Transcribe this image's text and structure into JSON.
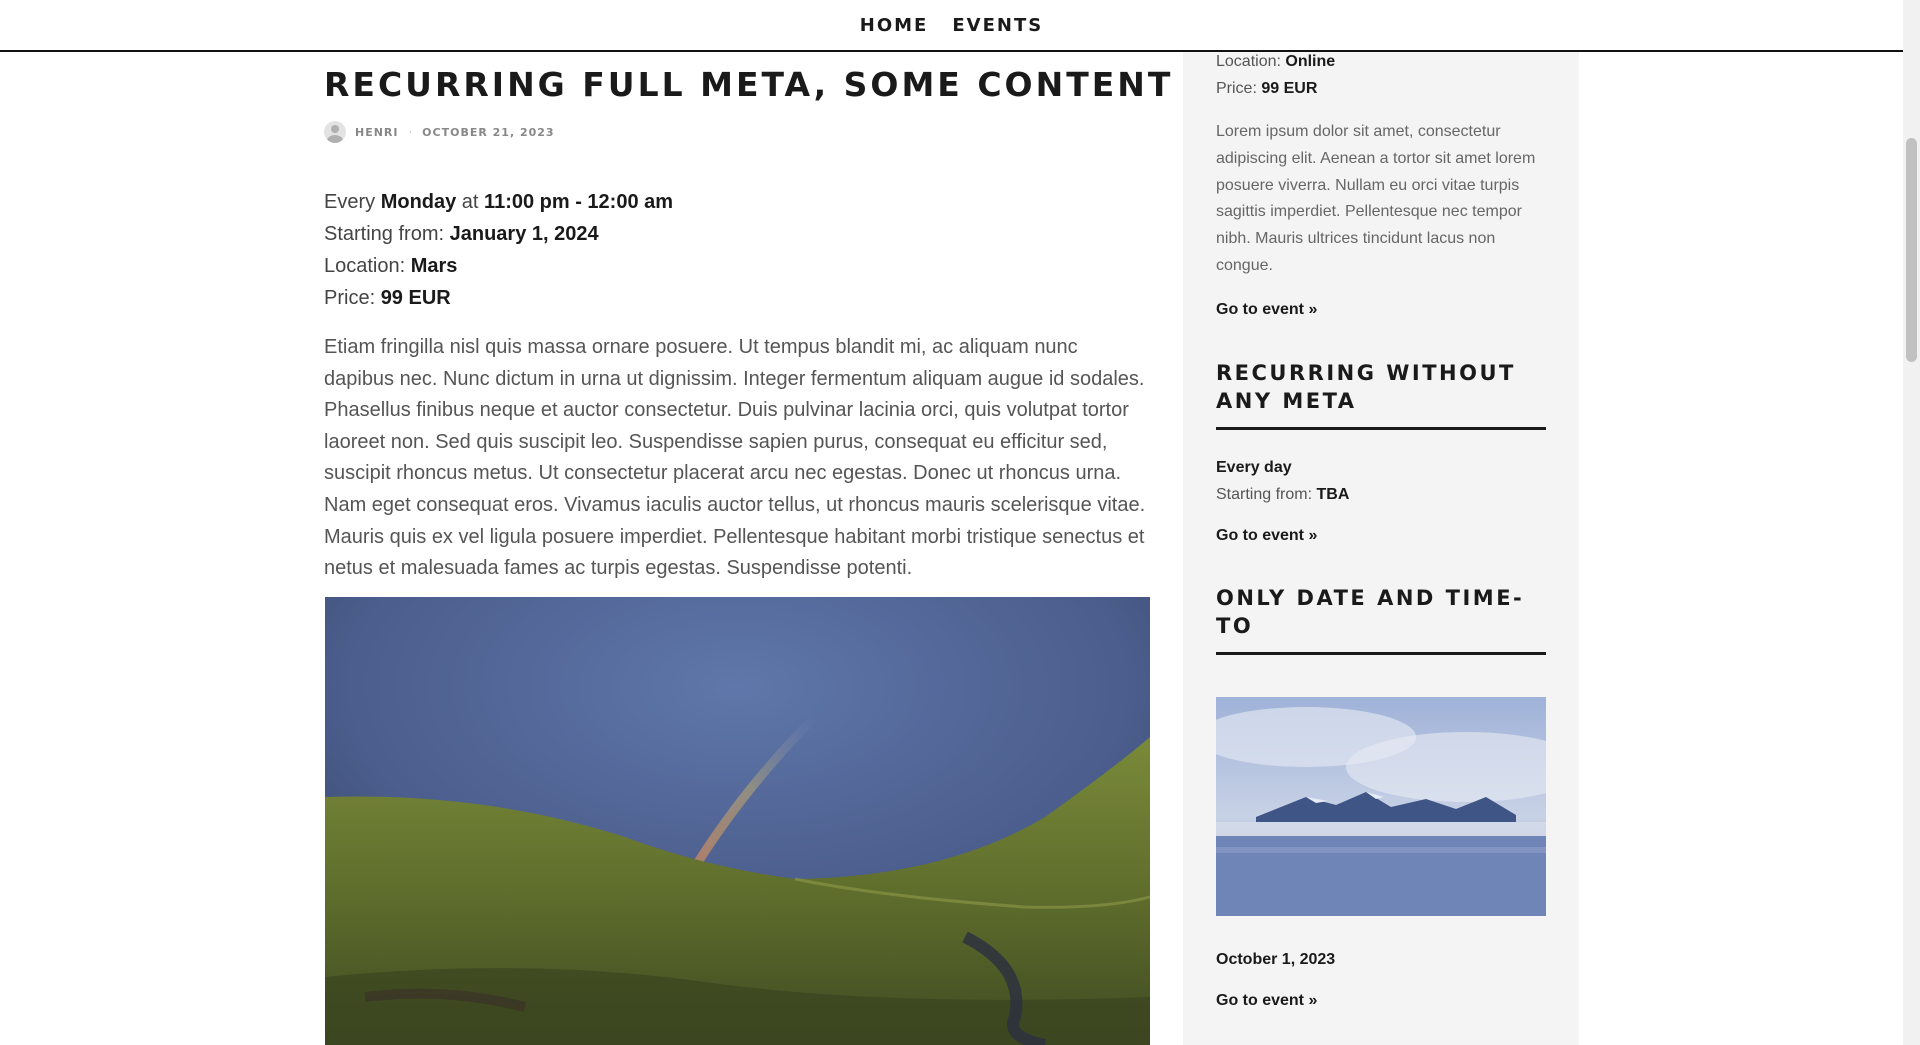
{
  "nav": {
    "items": [
      {
        "label": "HOME"
      },
      {
        "label": "EVENTS"
      }
    ]
  },
  "post": {
    "title": "RECURRING FULL META, SOME CONTENT",
    "author": "HENRI",
    "separator": "·",
    "date": "OCTOBER 21, 2023",
    "meta": {
      "every_prefix": "Every ",
      "day": "Monday",
      "at": " at ",
      "time": "11:00 pm - 12:00 am",
      "starting_label": "Starting from: ",
      "starting_value": "January 1, 2024",
      "location_label": "Location: ",
      "location_value": "Mars",
      "price_label": "Price: ",
      "price_value": "99 EUR"
    },
    "body": "Etiam fringilla nisl quis massa ornare posuere. Ut tempus blandit mi, ac aliquam nunc dapibus nec. Nunc dictum in urna ut dignissim. Integer fermentum aliquam augue id sodales. Phasellus finibus neque et auctor consectetur. Duis pulvinar lacinia orci, quis volutpat tortor laoreet non. Sed quis suscipit leo. Suspendisse sapien purus, consequat eu efficitur sed, suscipit rhoncus metus. Ut consectetur placerat arcu nec egestas. Donec ut rhoncus urna. Nam eget consequat eros. Vivamus iaculis auctor tellus, ut rhoncus mauris scelerisque vitae. Mauris quis ex vel ligula posuere imperdiet. Pellentesque habitant morbi tristique senectus et netus et malesuada fames ac turpis egestas. Suspendisse potenti."
  },
  "sidebar": {
    "top_event": {
      "location_label": "Location: ",
      "location_value": "Online",
      "price_label": "Price: ",
      "price_value": "99 EUR",
      "excerpt": "Lorem ipsum dolor sit amet, consectetur adipiscing elit. Aenean a tortor sit amet lorem posuere viverra. Nullam eu orci vitae turpis sagittis imperdiet. Pellentesque nec tempor nibh. Mauris ultrices tincidunt lacus non congue.",
      "link": "Go to event »"
    },
    "event2": {
      "title": "RECURRING WITHOUT ANY META",
      "recurrence": "Every day",
      "starting_label": "Starting from: ",
      "starting_value": "TBA",
      "link": "Go to event »"
    },
    "event3": {
      "title": "ONLY DATE AND TIME-TO",
      "date": "October 1, 2023",
      "link": "Go to event »"
    }
  },
  "colors": {
    "text_dark": "#1a1a1a",
    "sidebar_bg": "#f4f4f4"
  }
}
